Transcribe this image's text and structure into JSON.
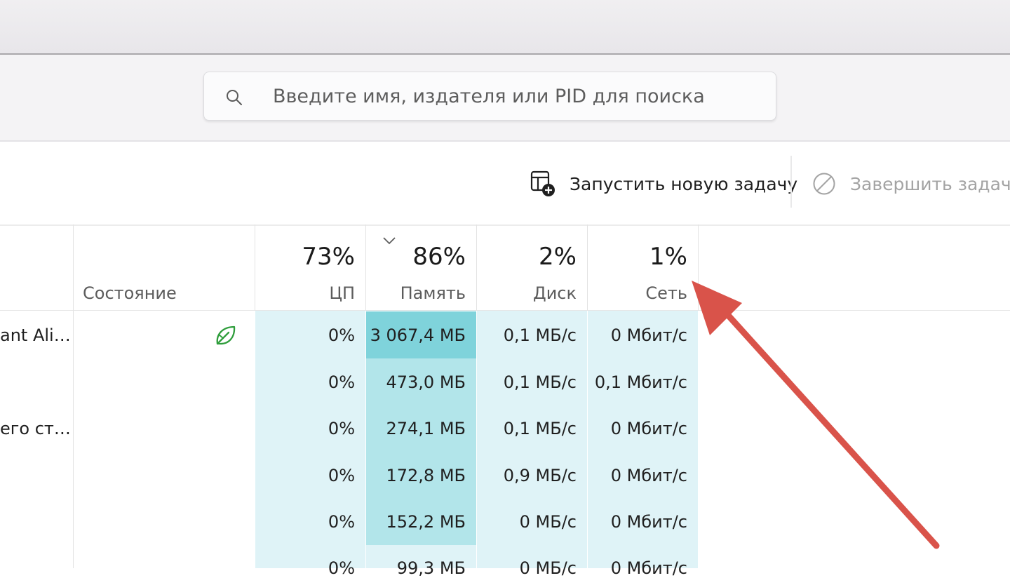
{
  "search": {
    "placeholder": "Введите имя, издателя или PID для поиска"
  },
  "toolbar": {
    "run_new_task": "Запустить новую задачу",
    "end_task": "Завершить задачу"
  },
  "columns": {
    "state": "Состояние",
    "cpu": {
      "percent": "73%",
      "label": "ЦП"
    },
    "memory": {
      "percent": "86%",
      "label": "Память"
    },
    "disk": {
      "percent": "2%",
      "label": "Диск"
    },
    "network": {
      "percent": "1%",
      "label": "Сеть"
    }
  },
  "rows": [
    {
      "name": "ant Ali…",
      "eco": true,
      "cpu": "0%",
      "memory": "3 067,4 МБ",
      "disk": "0,1 МБ/с",
      "network": "0 Мбит/с"
    },
    {
      "name": "",
      "eco": false,
      "cpu": "0%",
      "memory": "473,0 МБ",
      "disk": "0,1 МБ/с",
      "network": "0,1 Мбит/с"
    },
    {
      "name": "его ст…",
      "eco": false,
      "cpu": "0%",
      "memory": "274,1 МБ",
      "disk": "0,1 МБ/с",
      "network": "0 Мбит/с"
    },
    {
      "name": "",
      "eco": false,
      "cpu": "0%",
      "memory": "172,8 МБ",
      "disk": "0,9 МБ/с",
      "network": "0 Мбит/с"
    },
    {
      "name": "",
      "eco": false,
      "cpu": "0%",
      "memory": "152,2 МБ",
      "disk": "0 МБ/с",
      "network": "0 Мбит/с"
    },
    {
      "name": "",
      "eco": false,
      "cpu": "0%",
      "memory": "99,3 МБ",
      "disk": "0 МБ/с",
      "network": "0 Мбит/с"
    }
  ],
  "colors": {
    "heat_light": "#dff3f7",
    "heat_medium": "#b2e5ea",
    "heat_strong": "#7fd3db",
    "eco_green": "#2e9d3b",
    "arrow_red": "#d9534a"
  },
  "icons": {
    "search": "search-icon",
    "run_task": "new-task-icon",
    "end_task": "end-task-icon",
    "sort": "chevron-down-icon",
    "eco": "leaf-icon",
    "annotation": "red-arrow-icon"
  }
}
